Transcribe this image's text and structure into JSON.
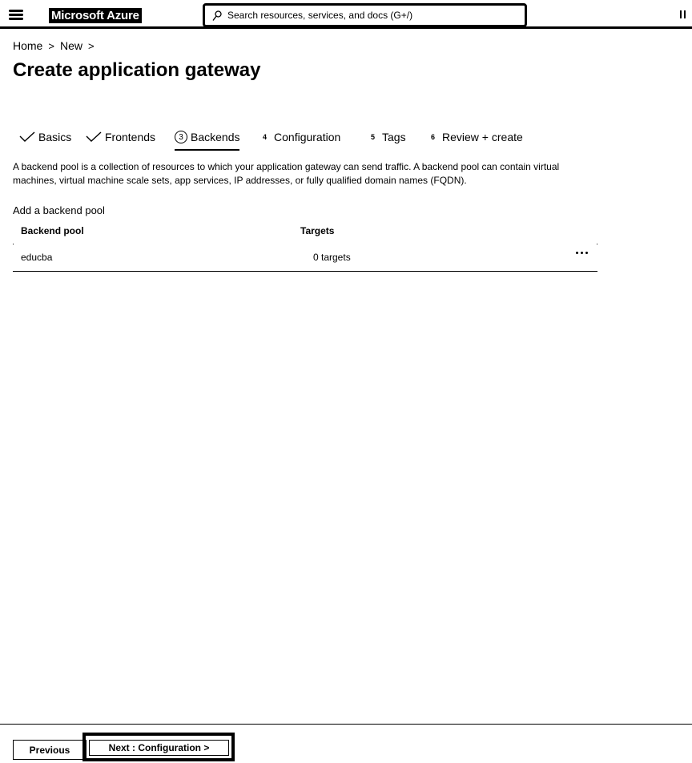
{
  "header": {
    "brand": "Microsoft Azure",
    "search_placeholder": "Search resources, services, and docs (G+/)",
    "icons": [
      "menu-icon",
      "search-icon",
      "pause-icon"
    ]
  },
  "breadcrumb": {
    "items": [
      "Home",
      "New"
    ],
    "separator": ">"
  },
  "page": {
    "title": "Create application gateway"
  },
  "tabs": [
    {
      "label": "Basics",
      "state": "done"
    },
    {
      "label": "Frontends",
      "state": "done"
    },
    {
      "label": "Backends",
      "number": "3",
      "state": "active"
    },
    {
      "label": "Configuration",
      "number": "4",
      "state": "pending"
    },
    {
      "label": "Tags",
      "number": "5",
      "state": "pending"
    },
    {
      "label": "Review + create",
      "number": "6",
      "state": "pending"
    }
  ],
  "backends": {
    "description": "A backend pool is a collection of resources to which your application gateway can send traffic. A backend pool can contain virtual machines, virtual machine scale sets, app services, IP addresses, or fully qualified domain names (FQDN).",
    "add_link": "Add a backend pool",
    "columns": [
      "Backend pool",
      "Targets"
    ],
    "rows": [
      {
        "backend_pool": "educba",
        "targets": "0 targets"
      }
    ]
  },
  "footer": {
    "previous_label": "Previous",
    "next_label": "Next : Configuration >"
  }
}
